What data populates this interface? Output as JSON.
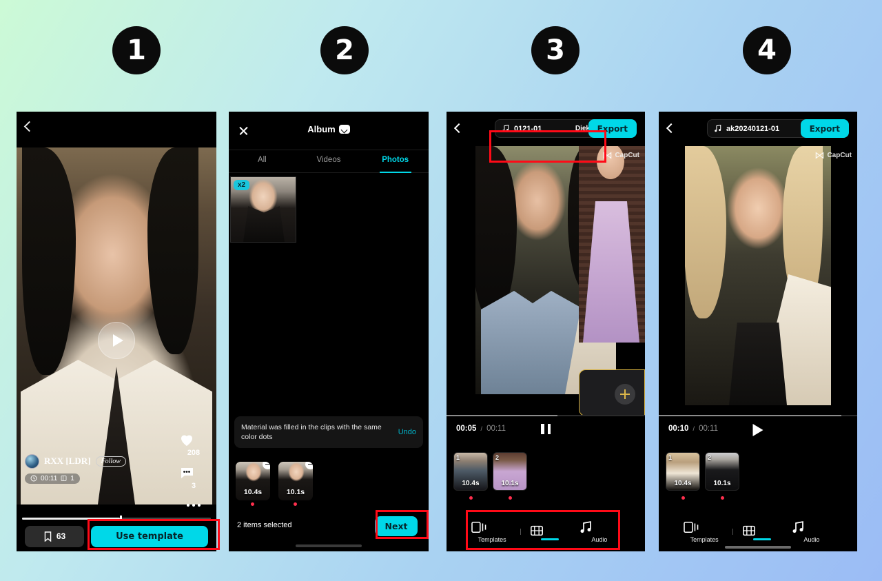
{
  "tutorial": {
    "steps": [
      "1",
      "2",
      "3",
      "4"
    ],
    "background_gradient": [
      "#ccfad6",
      "#9bbcf5"
    ],
    "accent_cyan": "#00d8e8",
    "highlight_red": "#ff0a17"
  },
  "panel1": {
    "name": "template-preview-screen",
    "back_icon": "chevron-left-icon",
    "play_icon": "play-icon",
    "likes": {
      "icon": "heart-icon",
      "count": "208"
    },
    "comments": {
      "icon": "comment-icon",
      "count": "3"
    },
    "more_icon": "more-options-icon",
    "username": "RXX [LDR]",
    "follow_label": "Follow",
    "duration": "00:11",
    "clip_count": "1",
    "clock_icon": "clock-icon",
    "clips_icon": "clips-icon",
    "bookmark": {
      "icon": "bookmark-icon",
      "count": "63"
    },
    "use_template_label": "Use template",
    "progress_percent": 52
  },
  "panel2": {
    "name": "album-picker-screen",
    "close_icon": "close-icon",
    "title": "Album",
    "title_dropdown_icon": "chevron-down-icon",
    "tabs": [
      {
        "label": "All",
        "active": false
      },
      {
        "label": "Videos",
        "active": false
      },
      {
        "label": "Photos",
        "active": true
      }
    ],
    "thumbnail_badge": "x2",
    "toast_message": "Material was filled in the clips with the same color dots",
    "undo_label": "Undo",
    "clips": [
      {
        "duration": "10.4s",
        "remove_icon": "minus-circle-icon",
        "dot_color": "#ff2f4d"
      },
      {
        "duration": "10.1s",
        "remove_icon": "minus-circle-icon",
        "dot_color": "#ff2f4d"
      }
    ],
    "selection_status": "2 items selected",
    "next_label": "Next"
  },
  "panel3": {
    "name": "capcut-editor-playing",
    "back_icon": "chevron-left-icon",
    "music_icon": "music-note-icon",
    "music_title": "0121-01",
    "music_author": "Diek",
    "export_label": "Export",
    "watermark": "CapCut",
    "watermark_icon": "capcut-logo-icon",
    "add_clip_icon": "plus-icon",
    "time_current": "00:05",
    "time_total": "00:11",
    "transport_icon": "pause-icon",
    "stage_progress_percent": 56,
    "clips": [
      {
        "index": "1",
        "duration": "10.4s"
      },
      {
        "index": "2",
        "duration": "10.1s"
      }
    ],
    "nav": [
      {
        "label": "Templates",
        "icon": "templates-icon",
        "active": false
      },
      {
        "label": "",
        "icon": "edit-filmstrip-icon",
        "active": true
      },
      {
        "label": "Audio",
        "icon": "music-note-icon",
        "active": false
      }
    ]
  },
  "panel4": {
    "name": "capcut-editor-paused",
    "back_icon": "chevron-left-icon",
    "music_icon": "music-note-icon",
    "music_title": "ak20240121-01",
    "export_label": "Export",
    "watermark": "CapCut",
    "watermark_icon": "capcut-logo-icon",
    "time_current": "00:10",
    "time_total": "00:11",
    "transport_icon": "play-icon",
    "stage_progress_percent": 92,
    "clips": [
      {
        "index": "1",
        "duration": "10.4s"
      },
      {
        "index": "2",
        "duration": "10.1s"
      }
    ],
    "nav": [
      {
        "label": "Templates",
        "icon": "templates-icon",
        "active": false
      },
      {
        "label": "",
        "icon": "edit-filmstrip-icon",
        "active": true
      },
      {
        "label": "Audio",
        "icon": "music-note-icon",
        "active": false
      }
    ]
  }
}
